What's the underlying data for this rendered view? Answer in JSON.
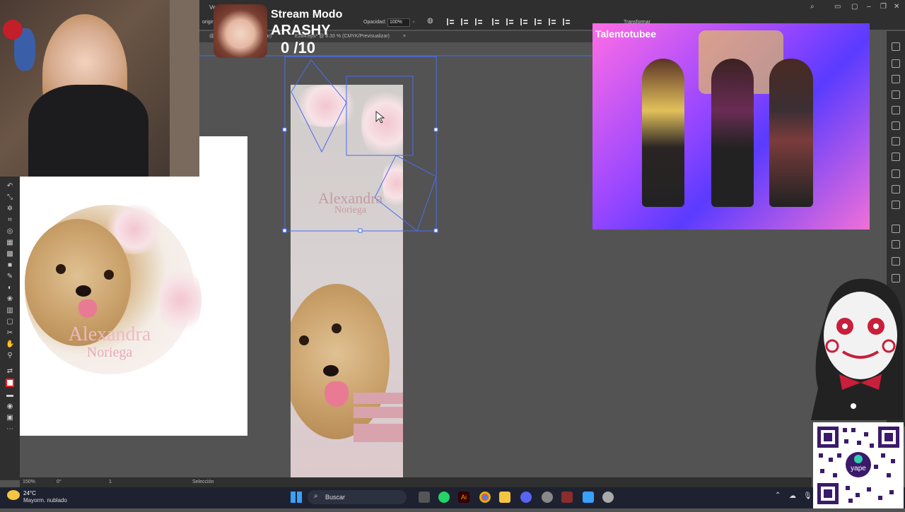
{
  "app": {
    "menu_left": "Ve",
    "tabs": [
      {
        "label": "origina"
      },
      {
        "label": "@ 150"
      },
      {
        "label": "zar)"
      },
      {
        "label": "E284.eps* @ 8.33 % (CMYK/Previsualizar)"
      },
      {
        "label": "×"
      }
    ],
    "options": {
      "opacity_label": "Opacidad:",
      "opacity_value": "100%",
      "transform_label": "Transformar"
    },
    "status": {
      "zoom": "150%",
      "angle": "0°",
      "artboard_index": "1",
      "tool_name": "Selección"
    }
  },
  "artwork": {
    "name": "Alexandra",
    "surname": "Noriega",
    "accent": "#f0b9c4"
  },
  "overlay": {
    "title": "Stream Modo",
    "user": "ARASHY",
    "counter": "0  /10"
  },
  "video": {
    "label": "Talentotubee"
  },
  "taskbar": {
    "temperature": "24°C",
    "weather": "Mayorm. nublado",
    "search_label": "Buscar"
  }
}
